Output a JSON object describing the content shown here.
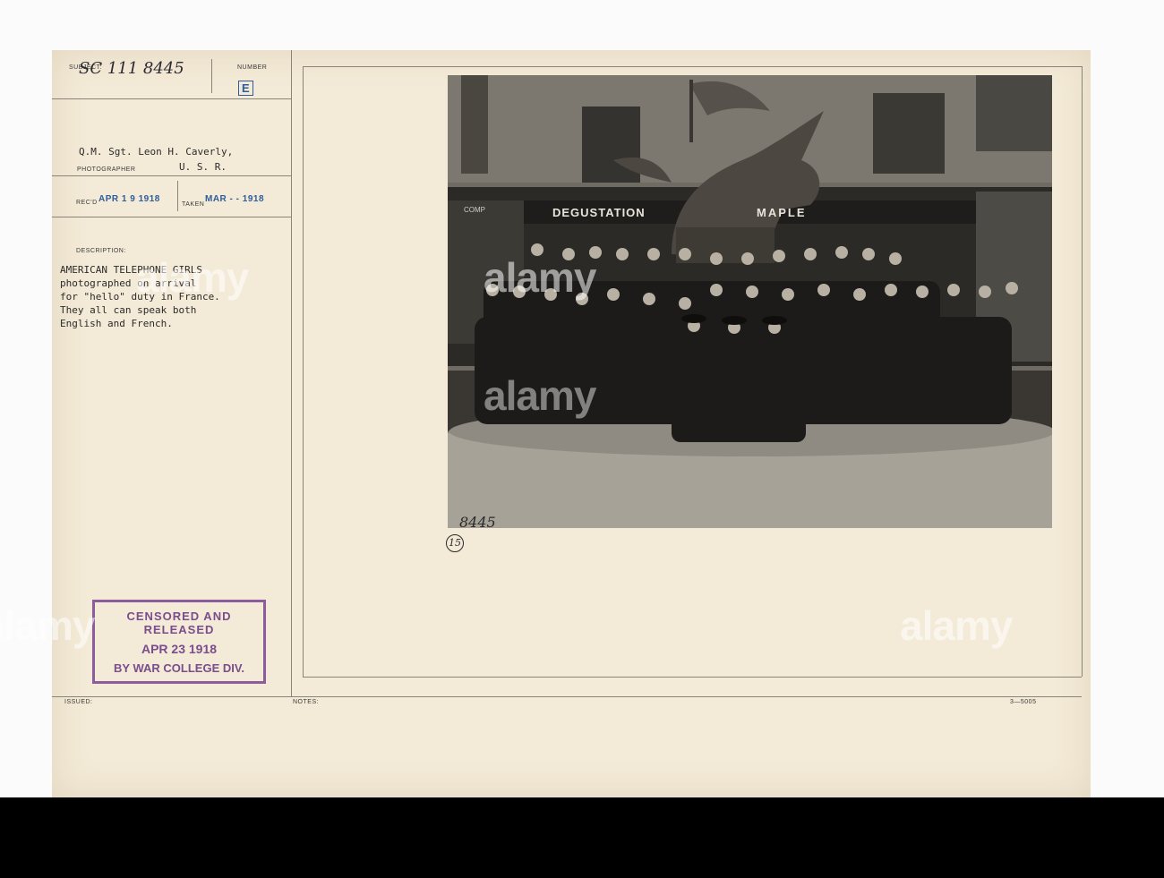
{
  "header": {
    "subject_label": "SUBJECT:",
    "subject_value": "SC 111 8445",
    "number_label": "NUMBER",
    "number_value": "E"
  },
  "photographer": {
    "name_line": "Q.M. Sgt. Leon H. Caverly,",
    "label": "PHOTOGRAPHER",
    "unit": "U. S. R."
  },
  "dates": {
    "recd_label": "REC'D",
    "recd_value": "APR 1 9 1918",
    "taken_label": "TAKEN",
    "taken_value": "MAR - - 1918"
  },
  "description": {
    "label": "DESCRIPTION:",
    "text": "AMERICAN TELEPHONE GIRLS\nphotographed on arrival\nfor \"hello\" duty in France.\nThey all can speak both\nEnglish and French."
  },
  "censor_stamp": {
    "line1": "CENSORED AND RELEASED",
    "line2": "APR 23 1918",
    "line3": "BY WAR COLLEGE DIV."
  },
  "footer_labels": {
    "issued": "ISSUED:",
    "notes": "NOTES:",
    "form_number": "3—5005"
  },
  "photo": {
    "sign_left": "DEGUSTATION",
    "sign_right": "MAPLE",
    "sign_small": "COMP",
    "negative_number": "8445",
    "circle_number": "15"
  },
  "watermarks": [
    "alamy",
    "alamy",
    "alamy",
    "alamy",
    "alamy"
  ],
  "colors": {
    "card": "#f3ead7",
    "blue_stamp": "#2e5d9c",
    "censor_stamp": "#8c5c9c",
    "footer_bar": "#000000"
  }
}
